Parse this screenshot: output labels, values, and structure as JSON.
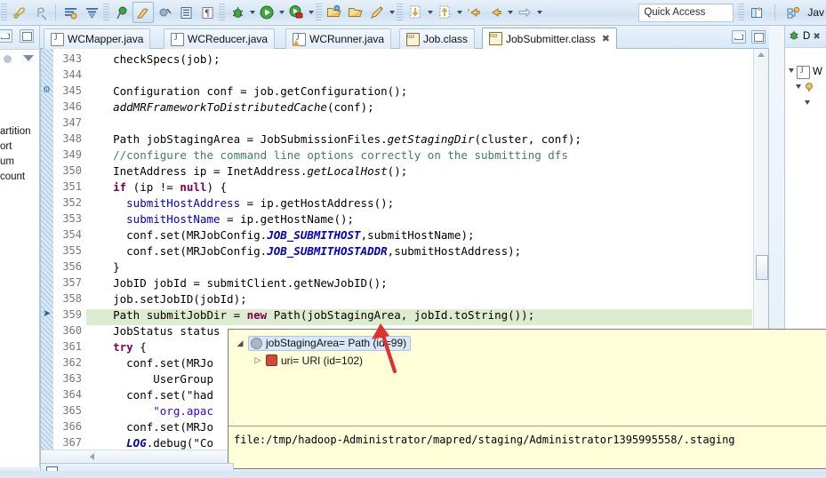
{
  "toolbar": {
    "quick_access_placeholder": "Quick Access",
    "perspective_label": "Jav",
    "icons": [
      "annotate-icon",
      "remove-annotation-icon",
      "outline-icon",
      "filter-icon",
      "marker-icon",
      "highlight-icon",
      "skip-breakpoints-icon",
      "table-icon",
      "paragraph-icon",
      "debug-icon",
      "run-icon",
      "coverage-icon",
      "open-type-icon",
      "open-resource-icon",
      "pencil-icon",
      "next-annotation-icon",
      "previous-annotation-icon",
      "back-icon",
      "forward-icon",
      "next-edit-icon"
    ],
    "new-perspective-icon": "new-perspective-icon"
  },
  "left_panel": {
    "rows": [
      "artition",
      "ort",
      "um",
      "count"
    ]
  },
  "editor": {
    "tabs": [
      {
        "label": "WCMapper.java",
        "icon": "java-file-icon",
        "active": false,
        "warn": false
      },
      {
        "label": "WCReducer.java",
        "icon": "java-file-icon",
        "active": false,
        "warn": false
      },
      {
        "label": "WCRunner.java",
        "icon": "java-file-icon",
        "active": false,
        "warn": true
      },
      {
        "label": "Job.class",
        "icon": "class-file-icon",
        "active": false,
        "warn": false
      },
      {
        "label": "JobSubmitter.class",
        "icon": "class-file-icon",
        "active": true,
        "warn": false
      }
    ],
    "close_glyph": "✖",
    "minimize_label": "minimize-button",
    "maximize_label": "maximize-button",
    "first_line": 343,
    "highlight_line": 359,
    "markers": [
      {
        "line": 345,
        "kind": "wrench"
      },
      {
        "line": 359,
        "kind": "current-instruction-arrow"
      }
    ],
    "lines": [
      {
        "n": 343,
        "segments": [
          {
            "t": "    checkSpecs(job);",
            "c": "pl"
          }
        ]
      },
      {
        "n": 344,
        "segments": [
          {
            "t": "",
            "c": "pl"
          }
        ]
      },
      {
        "n": 345,
        "segments": [
          {
            "t": "    Configuration conf = job.getConfiguration();",
            "c": "pl"
          }
        ]
      },
      {
        "n": 346,
        "segments": [
          {
            "t": "    addMRFrameworkToDistributedCache",
            "c": "mi"
          },
          {
            "t": "(conf);",
            "c": "pl"
          }
        ]
      },
      {
        "n": 347,
        "segments": [
          {
            "t": "",
            "c": "pl"
          }
        ]
      },
      {
        "n": 348,
        "segments": [
          {
            "t": "    Path jobStagingArea = JobSubmissionFiles.",
            "c": "pl"
          },
          {
            "t": "getStagingDir",
            "c": "mi"
          },
          {
            "t": "(cluster, conf);",
            "c": "pl"
          }
        ]
      },
      {
        "n": 349,
        "segments": [
          {
            "t": "    //configure the command line options correctly on the submitting dfs",
            "c": "cm"
          }
        ]
      },
      {
        "n": 350,
        "segments": [
          {
            "t": "    InetAddress ip = InetAddress.",
            "c": "pl"
          },
          {
            "t": "getLocalHost",
            "c": "mi"
          },
          {
            "t": "();",
            "c": "pl"
          }
        ]
      },
      {
        "n": 351,
        "segments": [
          {
            "t": "    if",
            "c": "kw"
          },
          {
            "t": " (ip != ",
            "c": "pl"
          },
          {
            "t": "null",
            "c": "kw"
          },
          {
            "t": ") {",
            "c": "pl"
          }
        ]
      },
      {
        "n": 352,
        "segments": [
          {
            "t": "      ",
            "c": "pl"
          },
          {
            "t": "submitHostAddress",
            "c": "fld"
          },
          {
            "t": " = ip.getHostAddress();",
            "c": "pl"
          }
        ]
      },
      {
        "n": 353,
        "segments": [
          {
            "t": "      ",
            "c": "pl"
          },
          {
            "t": "submitHostName",
            "c": "fld"
          },
          {
            "t": " = ip.getHostName();",
            "c": "pl"
          }
        ]
      },
      {
        "n": 354,
        "segments": [
          {
            "t": "      conf.set(MRJobConfig.",
            "c": "pl"
          },
          {
            "t": "JOB_SUBMITHOST",
            "c": "sf"
          },
          {
            "t": ",submitHostName);",
            "c": "pl"
          }
        ]
      },
      {
        "n": 355,
        "segments": [
          {
            "t": "      conf.set(MRJobConfig.",
            "c": "pl"
          },
          {
            "t": "JOB_SUBMITHOSTADDR",
            "c": "sf"
          },
          {
            "t": ",submitHostAddress);",
            "c": "pl"
          }
        ]
      },
      {
        "n": 356,
        "segments": [
          {
            "t": "    }",
            "c": "pl"
          }
        ]
      },
      {
        "n": 357,
        "segments": [
          {
            "t": "    JobID jobId = submitClient.getNewJobID();",
            "c": "pl"
          }
        ]
      },
      {
        "n": 358,
        "segments": [
          {
            "t": "    job.setJobID(jobId);",
            "c": "pl"
          }
        ]
      },
      {
        "n": 359,
        "segments": [
          {
            "t": "    Path submitJobDir = ",
            "c": "pl"
          },
          {
            "t": "new",
            "c": "kw"
          },
          {
            "t": " Path(jobStagingArea, jobId.toString());",
            "c": "pl"
          }
        ]
      },
      {
        "n": 360,
        "segments": [
          {
            "t": "    JobStatus status",
            "c": "pl"
          }
        ]
      },
      {
        "n": 361,
        "segments": [
          {
            "t": "    try",
            "c": "kw"
          },
          {
            "t": " {",
            "c": "pl"
          }
        ]
      },
      {
        "n": 362,
        "segments": [
          {
            "t": "      conf.set(MRJo",
            "c": "pl"
          }
        ]
      },
      {
        "n": 363,
        "segments": [
          {
            "t": "          UserGroup",
            "c": "pl"
          }
        ]
      },
      {
        "n": 364,
        "segments": [
          {
            "t": "      conf.set(\"had",
            "c": "pl"
          }
        ]
      },
      {
        "n": 365,
        "segments": [
          {
            "t": "          \"org.apac",
            "c": "st"
          }
        ]
      },
      {
        "n": 366,
        "segments": [
          {
            "t": "      conf.set(MRJo",
            "c": "pl"
          }
        ]
      },
      {
        "n": 367,
        "segments": [
          {
            "t": "      LOG",
            "c": "sf"
          },
          {
            "t": ".debug(\"Co",
            "c": "pl"
          }
        ]
      }
    ]
  },
  "right_panel": {
    "view_label": "D",
    "close_glyph": "✖",
    "tree": [
      "W"
    ]
  },
  "popup": {
    "rows": [
      {
        "label": "jobStagingArea= Path  (id=99)",
        "expander": "◢",
        "icon": "object-icon",
        "selected": true,
        "indent": 0
      },
      {
        "label": "uri= URI  (id=102)",
        "expander": "▷",
        "icon": "field-icon",
        "selected": false,
        "indent": 1
      }
    ],
    "value": "file:/tmp/hadoop-Administrator/mapred/staging/Administrator1395995558/.staging"
  },
  "bottom_panel": {
    "tab_label": "",
    "icon": "console-icon"
  },
  "annotation": {
    "name": "red-arrow-annotation",
    "color": "#e03030"
  },
  "colors": {
    "highlight_line": "#ddeccf",
    "popup_background": "#feffd9",
    "keyword": "#7f0055",
    "comment": "#3f7f5f",
    "string": "#2a00ff",
    "field": "#0000c0",
    "accent": "#3a6ea5"
  }
}
